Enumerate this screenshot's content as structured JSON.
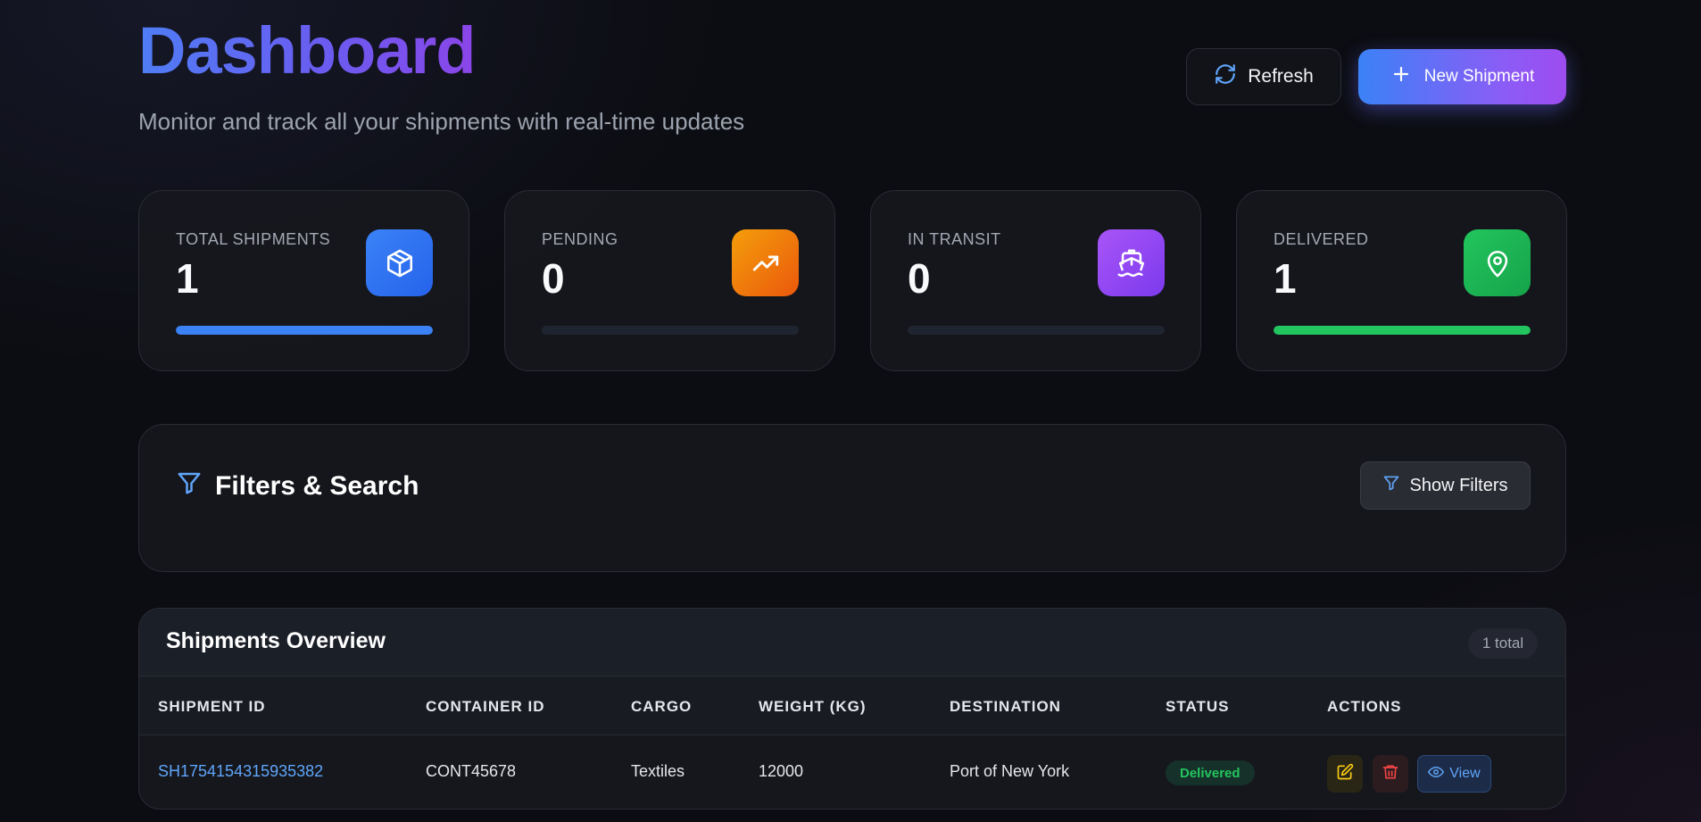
{
  "header": {
    "title": "Dashboard",
    "subtitle": "Monitor and track all your shipments with real-time updates",
    "refresh_label": "Refresh",
    "new_shipment_label": "New Shipment"
  },
  "stats": [
    {
      "label": "TOTAL SHIPMENTS",
      "value": "1",
      "icon": "package-icon",
      "color": "#3b82f6",
      "progress": 1.0
    },
    {
      "label": "PENDING",
      "value": "0",
      "icon": "trending-up-icon",
      "color": "#f59e0b",
      "progress": 0.0
    },
    {
      "label": "IN TRANSIT",
      "value": "0",
      "icon": "ship-icon",
      "color": "#8b5cf6",
      "progress": 0.0
    },
    {
      "label": "DELIVERED",
      "value": "1",
      "icon": "map-pin-icon",
      "color": "#22c55e",
      "progress": 1.0
    }
  ],
  "filters": {
    "title": "Filters & Search",
    "show_filters_label": "Show Filters"
  },
  "table": {
    "title": "Shipments Overview",
    "total_badge": "1 total",
    "columns": [
      "SHIPMENT ID",
      "CONTAINER ID",
      "CARGO",
      "WEIGHT (KG)",
      "DESTINATION",
      "STATUS",
      "ACTIONS"
    ],
    "rows": [
      {
        "shipment_id": "SH1754154315935382",
        "container_id": "CONT45678",
        "cargo": "Textiles",
        "weight": "12000",
        "destination": "Port of New York",
        "status": "Delivered",
        "view_label": "View"
      }
    ]
  },
  "colors": {
    "accent_blue": "#3b82f6",
    "accent_purple": "#8b5cf6",
    "status_delivered": "#22c55e"
  }
}
